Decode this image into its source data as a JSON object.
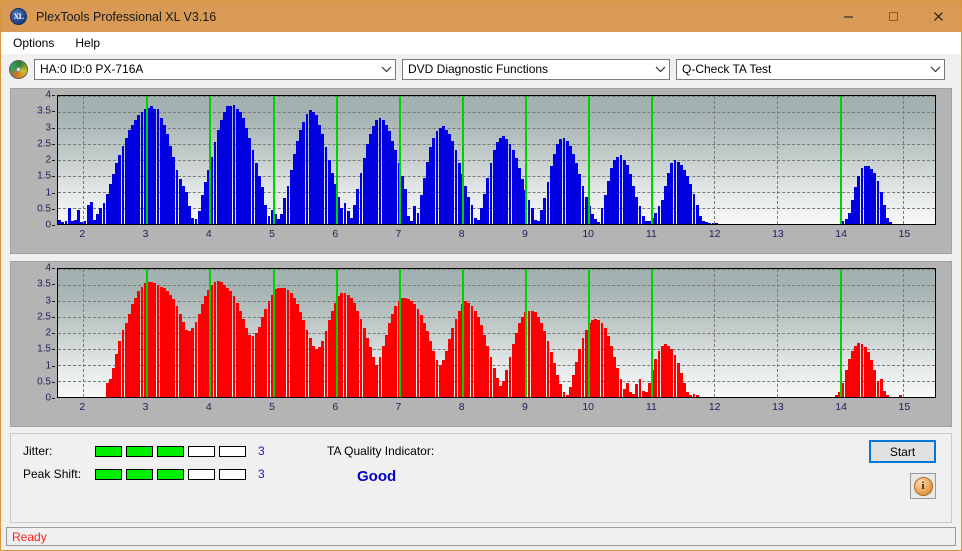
{
  "window": {
    "title": "PlexTools Professional XL V3.16",
    "app_icon": "XL",
    "minimize_label": "–",
    "maximize_label": "□",
    "close_label": "×",
    "titlebar_color": "#d89a55"
  },
  "menubar": {
    "items": [
      {
        "label": "Options"
      },
      {
        "label": "Help"
      }
    ]
  },
  "toolbar": {
    "drive_select": "HA:0 ID:0  PX-716A",
    "function_select": "DVD Diagnostic Functions",
    "test_select": "Q-Check TA Test"
  },
  "results": {
    "jitter_label": "Jitter:",
    "jitter_value": "3",
    "jitter_filled": 3,
    "jitter_total": 5,
    "peak_shift_label": "Peak Shift:",
    "peak_shift_value": "3",
    "peak_shift_filled": 3,
    "peak_shift_total": 5,
    "ta_quality_label": "TA Quality Indicator:",
    "ta_quality_value": "Good",
    "start_label": "Start",
    "info_label": "i",
    "bar_on_color": "#00ee00",
    "value_color": "#1818c0",
    "quality_color": "#0000c8"
  },
  "statusbar": {
    "text": "Ready",
    "color": "#ff2020"
  },
  "chart_data": [
    {
      "type": "bar",
      "title": "Q-Check TA Test - Jitter",
      "xlabel": "",
      "ylabel": "",
      "series_color": "#0000e0",
      "marker_color": "#00d200",
      "xlim": [
        1.6,
        15.5
      ],
      "ylim": [
        0,
        4
      ],
      "xticks": [
        2,
        3,
        4,
        5,
        6,
        7,
        8,
        9,
        10,
        11,
        12,
        13,
        14,
        15
      ],
      "yticks": [
        0,
        0.5,
        1,
        1.5,
        2,
        2.5,
        3,
        3.5,
        4
      ],
      "ytick_labels": [
        "0",
        "0.5",
        "1",
        "1.5",
        "2",
        "2.5",
        "3",
        "3.5",
        "4"
      ],
      "xtick_labels": [
        "2",
        "3",
        "4",
        "5",
        "6",
        "7",
        "8",
        "9",
        "10",
        "11",
        "12",
        "13",
        "14",
        "15"
      ],
      "grid": true,
      "markers_at": [
        3,
        4,
        5,
        6,
        7,
        8,
        9,
        10,
        11,
        14
      ],
      "values": [
        0.12,
        0.05,
        0.1,
        0.5,
        0.08,
        0.12,
        0.45,
        0.06,
        0.08,
        0.6,
        0.7,
        0.12,
        0.3,
        0.5,
        0.65,
        0.95,
        1.25,
        1.55,
        1.9,
        2.15,
        2.45,
        2.7,
        2.95,
        3.1,
        3.25,
        3.4,
        3.5,
        3.6,
        3.62,
        3.68,
        3.6,
        3.58,
        3.3,
        3.1,
        2.8,
        2.45,
        2.1,
        1.7,
        1.4,
        1.2,
        1.0,
        0.55,
        0.2,
        0.15,
        0.4,
        0.9,
        1.3,
        1.7,
        2.1,
        2.55,
        2.95,
        3.25,
        3.5,
        3.68,
        3.7,
        3.72,
        3.6,
        3.5,
        3.3,
        3.0,
        2.7,
        2.3,
        1.9,
        1.5,
        1.15,
        0.6,
        0.25,
        0.45,
        0.3,
        0.15,
        0.3,
        0.8,
        1.2,
        1.7,
        2.2,
        2.6,
        2.95,
        3.2,
        3.45,
        3.55,
        3.5,
        3.4,
        3.1,
        2.8,
        2.4,
        2.0,
        1.6,
        1.25,
        0.85,
        0.5,
        0.65,
        0.4,
        0.2,
        0.6,
        1.1,
        1.6,
        2.05,
        2.5,
        2.8,
        3.05,
        3.25,
        3.3,
        3.25,
        3.1,
        2.9,
        2.6,
        2.3,
        1.9,
        1.5,
        1.1,
        0.25,
        0.1,
        0.55,
        0.35,
        0.9,
        1.45,
        1.95,
        2.4,
        2.7,
        2.9,
        3.0,
        3.05,
        2.95,
        2.8,
        2.6,
        2.3,
        1.9,
        1.55,
        1.2,
        0.85,
        0.6,
        0.18,
        0.12,
        0.5,
        0.95,
        1.45,
        1.9,
        2.3,
        2.55,
        2.7,
        2.75,
        2.65,
        2.5,
        2.3,
        2.05,
        1.75,
        1.4,
        1.05,
        0.75,
        0.5,
        0.12,
        0.1,
        0.45,
        0.8,
        1.3,
        1.8,
        2.2,
        2.5,
        2.65,
        2.7,
        2.6,
        2.45,
        2.2,
        1.9,
        1.55,
        1.2,
        0.85,
        0.55,
        0.3,
        0.15,
        0.05,
        0.5,
        0.9,
        1.35,
        1.75,
        2.0,
        2.1,
        2.15,
        2.0,
        1.85,
        1.55,
        1.2,
        0.85,
        0.55,
        0.25,
        0.1,
        0.08,
        0.2,
        0.35,
        0.55,
        0.75,
        1.2,
        1.6,
        1.9,
        2.0,
        1.95,
        1.85,
        1.7,
        1.5,
        1.25,
        0.95,
        0.6,
        0.25,
        0.08,
        0.05,
        0.03,
        0.02,
        0.02,
        0.0,
        0.0,
        0.0,
        0.0,
        0.0,
        0.0,
        0.0,
        0.0,
        0.0,
        0.0,
        0.0,
        0.0,
        0.0,
        0.0,
        0.0,
        0.0,
        0.0,
        0.0,
        0.0,
        0.0,
        0.0,
        0.0,
        0.0,
        0.0,
        0.0,
        0.0,
        0.0,
        0.0,
        0.0,
        0.0,
        0.0,
        0.0,
        0.0,
        0.0,
        0.0,
        0.0,
        0.0,
        0.0,
        0.0,
        0.1,
        0.15,
        0.35,
        0.75,
        1.15,
        1.5,
        1.75,
        1.82,
        1.8,
        1.72,
        1.6,
        1.35,
        1.0,
        0.6,
        0.2,
        0.05,
        0.0,
        0.0,
        0.0,
        0.0,
        0.0,
        0.0,
        0.0,
        0.0,
        0.0,
        0.0,
        0.0,
        0.0,
        0.0
      ]
    },
    {
      "type": "bar",
      "title": "Q-Check TA Test - Peak Shift",
      "xlabel": "",
      "ylabel": "",
      "series_color": "#fa0000",
      "marker_color": "#00d200",
      "xlim": [
        1.6,
        15.5
      ],
      "ylim": [
        0,
        4
      ],
      "xticks": [
        2,
        3,
        4,
        5,
        6,
        7,
        8,
        9,
        10,
        11,
        12,
        13,
        14,
        15
      ],
      "yticks": [
        0,
        0.5,
        1,
        1.5,
        2,
        2.5,
        3,
        3.5,
        4
      ],
      "ytick_labels": [
        "0",
        "0.5",
        "1",
        "1.5",
        "2",
        "2.5",
        "3",
        "3.5",
        "4"
      ],
      "xtick_labels": [
        "2",
        "3",
        "4",
        "5",
        "6",
        "7",
        "8",
        "9",
        "10",
        "11",
        "12",
        "13",
        "14",
        "15"
      ],
      "grid": true,
      "markers_at": [
        3,
        4,
        5,
        6,
        7,
        8,
        9,
        10,
        11,
        14
      ],
      "values": [
        0.0,
        0.0,
        0.0,
        0.0,
        0.0,
        0.0,
        0.0,
        0.0,
        0.0,
        0.0,
        0.0,
        0.0,
        0.0,
        0.0,
        0.0,
        0.45,
        0.55,
        0.9,
        1.35,
        1.75,
        2.1,
        2.3,
        2.6,
        2.9,
        3.1,
        3.3,
        3.45,
        3.55,
        3.6,
        3.58,
        3.55,
        3.5,
        3.45,
        3.4,
        3.3,
        3.2,
        3.05,
        2.85,
        2.6,
        2.35,
        2.1,
        2.05,
        2.15,
        2.35,
        2.6,
        2.9,
        3.15,
        3.35,
        3.5,
        3.6,
        3.62,
        3.58,
        3.5,
        3.4,
        3.3,
        3.15,
        2.95,
        2.7,
        2.45,
        2.15,
        1.95,
        1.9,
        2.0,
        2.2,
        2.5,
        2.75,
        3.0,
        3.2,
        3.38,
        3.42,
        3.4,
        3.4,
        3.35,
        3.25,
        3.1,
        2.9,
        2.65,
        2.4,
        2.1,
        1.85,
        1.6,
        1.5,
        1.55,
        1.75,
        2.05,
        2.4,
        2.7,
        2.95,
        3.15,
        3.25,
        3.25,
        3.2,
        3.1,
        2.95,
        2.7,
        2.45,
        2.15,
        1.85,
        1.55,
        1.25,
        1.0,
        1.25,
        1.6,
        1.95,
        2.3,
        2.6,
        2.85,
        3.0,
        3.1,
        3.1,
        3.05,
        3.0,
        2.9,
        2.75,
        2.55,
        2.3,
        2.05,
        1.75,
        1.45,
        1.15,
        1.0,
        1.15,
        1.45,
        1.8,
        2.15,
        2.45,
        2.7,
        2.9,
        3.0,
        2.95,
        2.85,
        2.7,
        2.5,
        2.25,
        1.95,
        1.6,
        1.25,
        0.9,
        0.6,
        0.35,
        0.5,
        0.85,
        1.25,
        1.65,
        2.0,
        2.3,
        2.5,
        2.65,
        2.7,
        2.7,
        2.65,
        2.5,
        2.3,
        2.05,
        1.75,
        1.4,
        1.05,
        0.7,
        0.4,
        0.15,
        0.05,
        0.3,
        0.7,
        1.1,
        1.5,
        1.85,
        2.1,
        2.3,
        2.4,
        2.45,
        2.4,
        2.3,
        2.15,
        1.9,
        1.6,
        1.25,
        0.9,
        0.55,
        0.25,
        0.45,
        0.15,
        0.1,
        0.4,
        0.55,
        0.2,
        0.15,
        0.45,
        0.85,
        1.2,
        1.45,
        1.6,
        1.65,
        1.6,
        1.5,
        1.3,
        1.05,
        0.75,
        0.45,
        0.15,
        0.05,
        0.1,
        0.05,
        0.0,
        0.0,
        0.0,
        0.0,
        0.0,
        0.0,
        0.0,
        0.0,
        0.0,
        0.0,
        0.0,
        0.0,
        0.0,
        0.0,
        0.0,
        0.0,
        0.0,
        0.0,
        0.0,
        0.0,
        0.0,
        0.0,
        0.0,
        0.0,
        0.0,
        0.0,
        0.0,
        0.0,
        0.0,
        0.0,
        0.0,
        0.0,
        0.0,
        0.0,
        0.0,
        0.0,
        0.0,
        0.0,
        0.0,
        0.0,
        0.0,
        0.0,
        0.0,
        0.05,
        0.15,
        0.45,
        0.85,
        1.2,
        1.45,
        1.6,
        1.68,
        1.65,
        1.55,
        1.4,
        1.15,
        0.85,
        0.5,
        0.55,
        0.2,
        0.05,
        0.0,
        0.0,
        0.0,
        0.05,
        0.0,
        0.0,
        0.0,
        0.0,
        0.0,
        0.0,
        0.0,
        0.0,
        0.0,
        0.0
      ]
    }
  ]
}
